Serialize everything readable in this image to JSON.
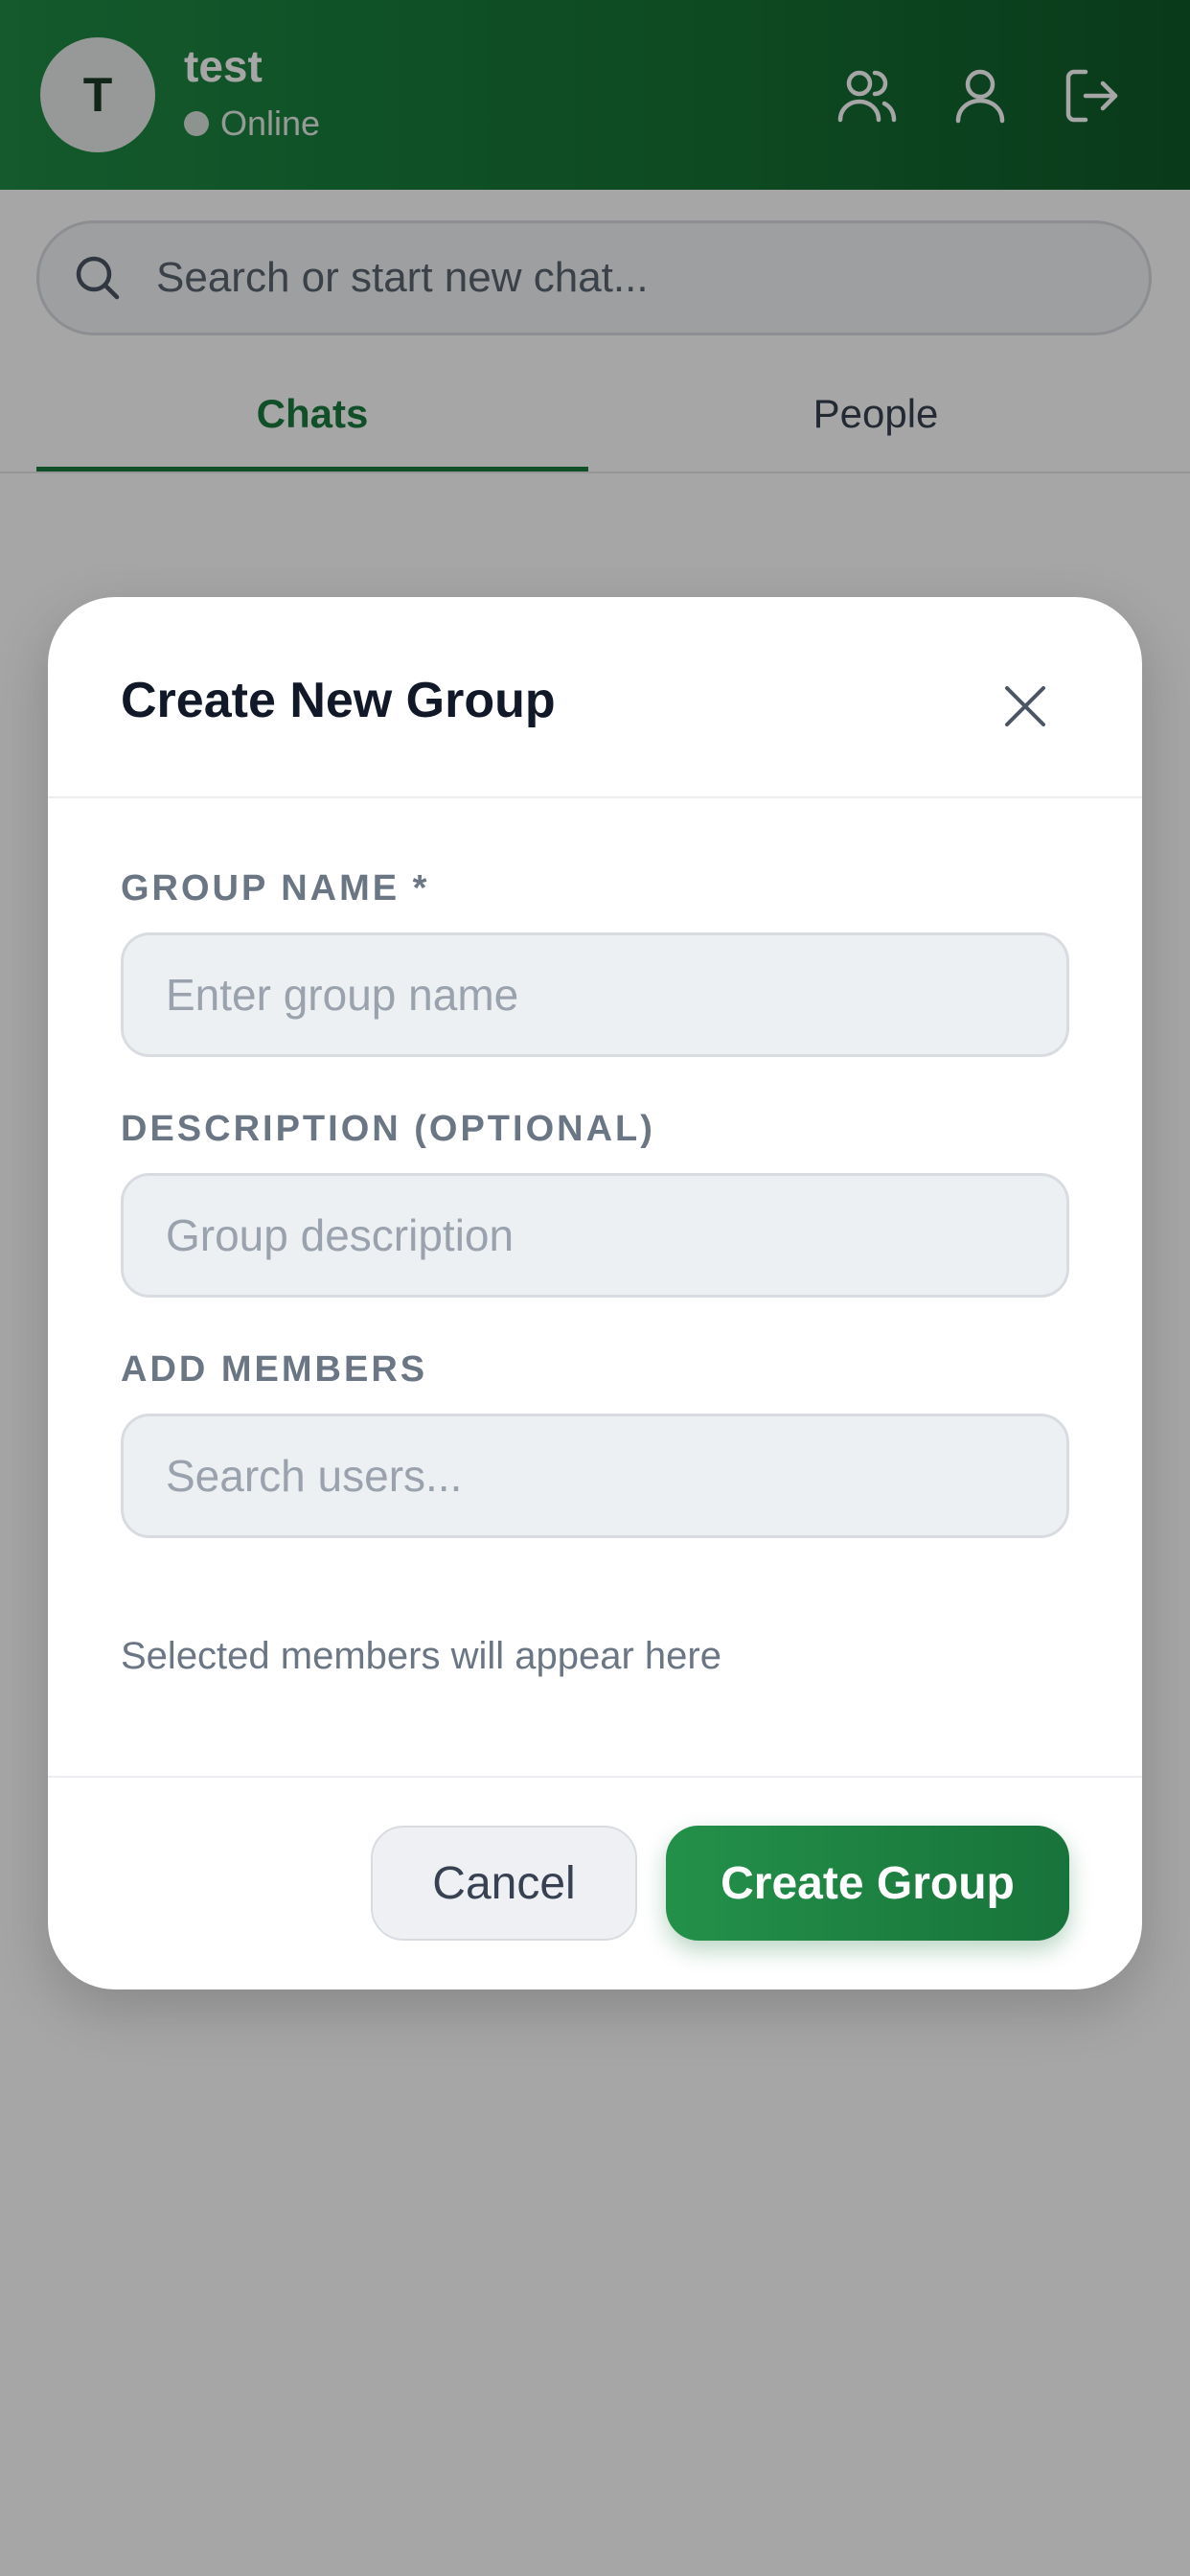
{
  "header": {
    "avatar_initial": "T",
    "username": "test",
    "status": "Online",
    "icons": [
      "create-group-icon",
      "profile-icon",
      "logout-icon"
    ]
  },
  "search": {
    "placeholder": "Search or start new chat..."
  },
  "tabs": [
    {
      "label": "Chats",
      "active": true
    },
    {
      "label": "People",
      "active": false
    }
  ],
  "modal": {
    "title": "Create New Group",
    "group_name_label": "GROUP NAME *",
    "group_name_placeholder": "Enter group name",
    "description_label": "DESCRIPTION (OPTIONAL)",
    "description_placeholder": "Group description",
    "members_label": "ADD MEMBERS",
    "members_placeholder": "Search users...",
    "members_hint": "Selected members will appear here",
    "cancel_label": "Cancel",
    "create_label": "Create Group"
  },
  "colors": {
    "brand": "#1a7a3c",
    "header_gradient_start": "#1f8a44",
    "header_gradient_end": "#0f5a29"
  }
}
